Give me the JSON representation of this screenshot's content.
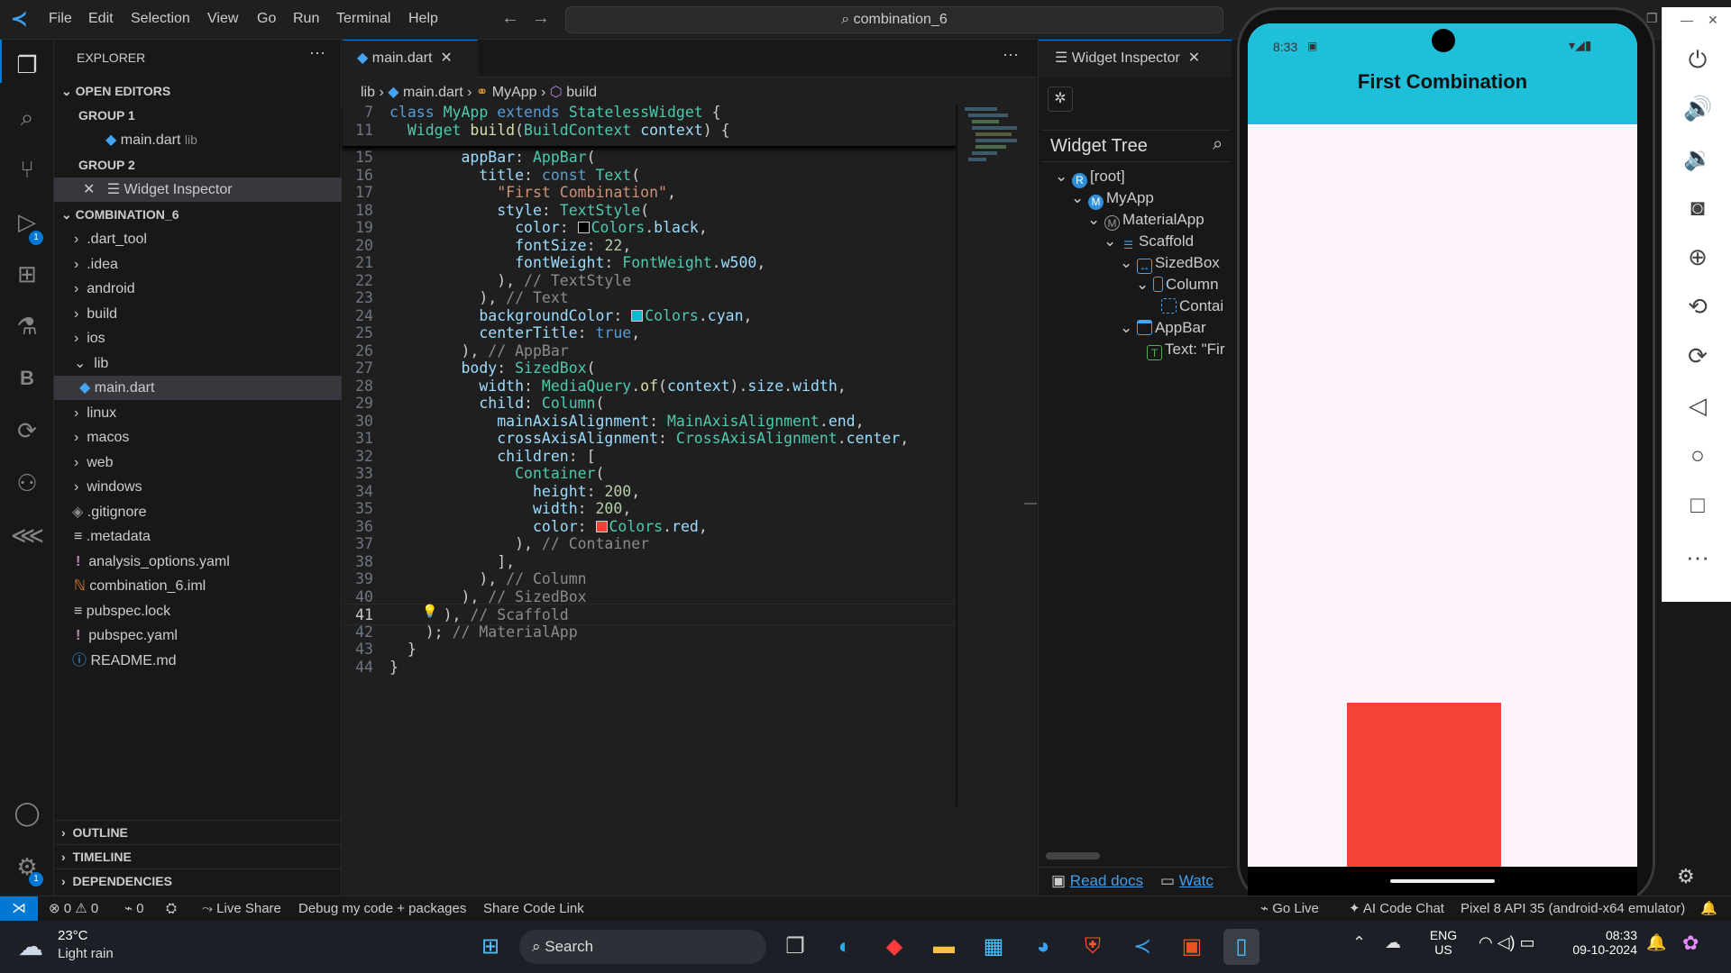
{
  "titlebar": {
    "menus": [
      "File",
      "Edit",
      "Selection",
      "View",
      "Go",
      "Run",
      "Terminal",
      "Help"
    ],
    "search": "combination_6"
  },
  "explorer": {
    "title": "EXPLORER",
    "open_editors": "OPEN EDITORS",
    "group1": "GROUP 1",
    "g1_file": "main.dart",
    "g1_dir": "lib",
    "group2": "GROUP 2",
    "g2_file": "Widget Inspector",
    "project": "COMBINATION_6",
    "items": [
      ".dart_tool",
      ".idea",
      "android",
      "build",
      "ios",
      "lib",
      "main.dart",
      "linux",
      "macos",
      "web",
      "windows",
      ".gitignore",
      ".metadata",
      "analysis_options.yaml",
      "combination_6.iml",
      "pubspec.lock",
      "pubspec.yaml",
      "README.md"
    ],
    "outline": "OUTLINE",
    "timeline": "TIMELINE",
    "dependencies": "DEPENDENCIES"
  },
  "editor": {
    "tab": "main.dart",
    "breadcrumb": [
      "lib",
      "main.dart",
      "MyApp",
      "build"
    ],
    "sticky": [
      {
        "n": "7",
        "t": "class MyApp extends StatelessWidget {"
      },
      {
        "n": "11",
        "t": "  Widget build(BuildContext context) {"
      }
    ],
    "lines": [
      {
        "n": "15",
        "t": "        appBar: AppBar("
      },
      {
        "n": "16",
        "t": "          title: const Text("
      },
      {
        "n": "17",
        "t": "            \"First Combination\","
      },
      {
        "n": "18",
        "t": "            style: TextStyle("
      },
      {
        "n": "19",
        "t": "              color: ■Colors.black,"
      },
      {
        "n": "20",
        "t": "              fontSize: 22,"
      },
      {
        "n": "21",
        "t": "              fontWeight: FontWeight.w500,"
      },
      {
        "n": "22",
        "t": "            ), // TextStyle"
      },
      {
        "n": "23",
        "t": "          ), // Text"
      },
      {
        "n": "24",
        "t": "          backgroundColor: ■Colors.cyan,"
      },
      {
        "n": "25",
        "t": "          centerTitle: true,"
      },
      {
        "n": "26",
        "t": "        ), // AppBar"
      },
      {
        "n": "27",
        "t": "        body: SizedBox("
      },
      {
        "n": "28",
        "t": "          width: MediaQuery.of(context).size.width,"
      },
      {
        "n": "29",
        "t": "          child: Column("
      },
      {
        "n": "30",
        "t": "            mainAxisAlignment: MainAxisAlignment.end,"
      },
      {
        "n": "31",
        "t": "            crossAxisAlignment: CrossAxisAlignment.center,"
      },
      {
        "n": "32",
        "t": "            children: ["
      },
      {
        "n": "33",
        "t": "              Container("
      },
      {
        "n": "34",
        "t": "                height: 200,"
      },
      {
        "n": "35",
        "t": "                width: 200,"
      },
      {
        "n": "36",
        "t": "                color: ■Colors.red,"
      },
      {
        "n": "37",
        "t": "              ), // Container"
      },
      {
        "n": "38",
        "t": "            ],"
      },
      {
        "n": "39",
        "t": "          ), // Column"
      },
      {
        "n": "40",
        "t": "        ), // SizedBox"
      },
      {
        "n": "41",
        "t": "      ), // Scaffold"
      },
      {
        "n": "42",
        "t": "    ); // MaterialApp"
      },
      {
        "n": "43",
        "t": "  }"
      },
      {
        "n": "44",
        "t": "}"
      }
    ]
  },
  "inspector": {
    "tab": "Widget Inspector",
    "tree_title": "Widget Tree",
    "nodes": [
      "[root]",
      "MyApp",
      "MaterialApp",
      "Scaffold",
      "SizedBox",
      "Column",
      "Contai",
      "AppBar",
      "Text: \"Fir"
    ],
    "read_docs": "Read docs",
    "watch": "Watc"
  },
  "phone": {
    "time": "8:33",
    "appbar_title": "First Combination",
    "appbar_color": "#1EC0D9",
    "box_color": "#F44336"
  },
  "statusbar": {
    "errors": "0",
    "warnings": "0",
    "ports": "0",
    "live_share": "Live Share",
    "debug": "Debug my code + packages",
    "share": "Share Code Link",
    "go_live": "Go Live",
    "ai": "AI Code Chat",
    "device": "Pixel 8 API 35 (android-x64 emulator)"
  },
  "taskbar": {
    "weather_temp": "23°C",
    "weather_desc": "Light rain",
    "search": "Search",
    "lang1": "ENG",
    "lang2": "US",
    "time": "08:33",
    "date": "09-10-2024"
  }
}
